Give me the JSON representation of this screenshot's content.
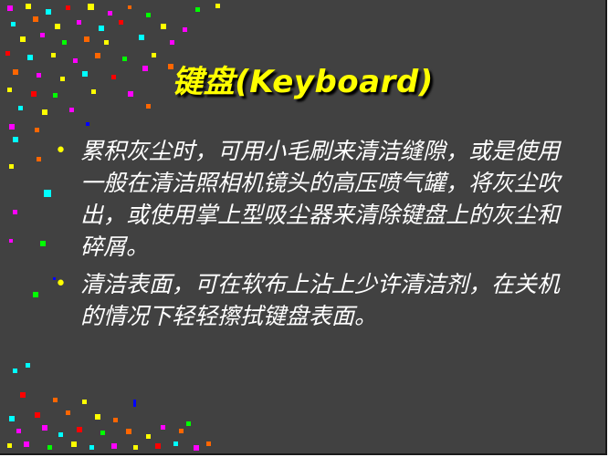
{
  "slide": {
    "title": "键盘(Keyboard)",
    "bullets": [
      {
        "text": "累积灰尘时，可用小毛刷来清洁缝隙，或是使用一般在清洁照相机镜头的高压喷气罐，将灰尘吹出，或使用掌上型吸尘器来清除键盘上的灰尘和碎屑。"
      },
      {
        "text": "清洁表面，可在软布上沾上少许清洁剂，在关机的情况下轻轻擦拭键盘表面。"
      }
    ],
    "bullet_symbol": "•"
  },
  "colors": {
    "background": "#414141",
    "title": "#ffff00",
    "body_text": "#ffffff",
    "bullet": "#ffff00"
  }
}
